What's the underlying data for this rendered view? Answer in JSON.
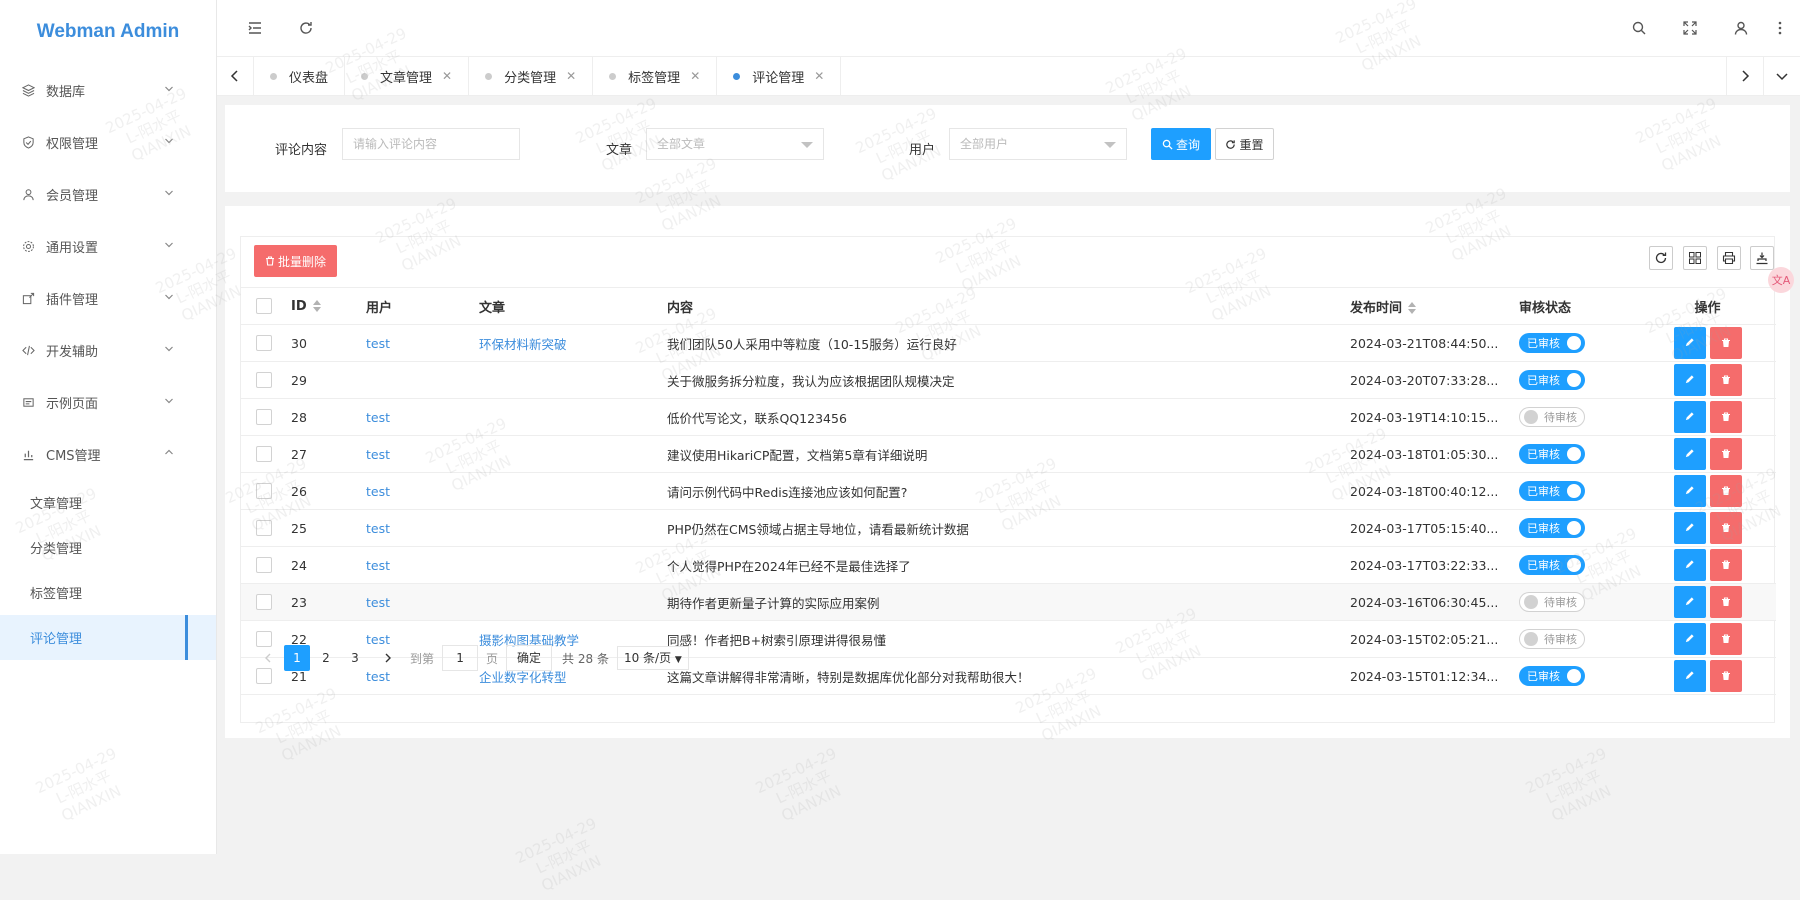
{
  "app": {
    "title": "Webman Admin"
  },
  "sidebar": {
    "items": [
      {
        "label": "数据库",
        "icon": "layers-icon"
      },
      {
        "label": "权限管理",
        "icon": "shield-icon"
      },
      {
        "label": "会员管理",
        "icon": "user-icon"
      },
      {
        "label": "通用设置",
        "icon": "gear-icon"
      },
      {
        "label": "插件管理",
        "icon": "plugin-icon"
      },
      {
        "label": "开发辅助",
        "icon": "code-icon"
      },
      {
        "label": "示例页面",
        "icon": "page-icon"
      },
      {
        "label": "CMS管理",
        "icon": "cms-icon"
      }
    ],
    "cms_children": [
      "文章管理",
      "分类管理",
      "标签管理",
      "评论管理"
    ],
    "active": "评论管理"
  },
  "tabs": [
    {
      "label": "仪表盘",
      "closable": false
    },
    {
      "label": "文章管理",
      "closable": true
    },
    {
      "label": "分类管理",
      "closable": true
    },
    {
      "label": "标签管理",
      "closable": true
    },
    {
      "label": "评论管理",
      "closable": true,
      "active": true
    }
  ],
  "search": {
    "content_label": "评论内容",
    "content_placeholder": "请输入评论内容",
    "article_label": "文章",
    "article_value": "全部文章",
    "user_label": "用户",
    "user_value": "全部用户",
    "query_label": "查询",
    "reset_label": "重置"
  },
  "toolbar": {
    "batch_delete_label": "批量删除"
  },
  "table": {
    "headers": {
      "id": "ID",
      "user": "用户",
      "article": "文章",
      "content": "内容",
      "time": "发布时间",
      "status": "审核状态",
      "actions": "操作"
    },
    "rows": [
      {
        "id": "30",
        "user": "test",
        "article": "环保材料新突破",
        "content": "我们团队50人采用中等粒度（10-15服务）运行良好",
        "time": "2024-03-21T08:44:50...",
        "status": "已审核",
        "approved": true
      },
      {
        "id": "29",
        "user": "",
        "article": "",
        "content": "关于微服务拆分粒度，我认为应该根据团队规模决定",
        "time": "2024-03-20T07:33:28...",
        "status": "已审核",
        "approved": true
      },
      {
        "id": "28",
        "user": "test",
        "article": "",
        "content": "低价代写论文，联系QQ123456",
        "time": "2024-03-19T14:10:15...",
        "status": "待审核",
        "approved": false
      },
      {
        "id": "27",
        "user": "test",
        "article": "",
        "content": "建议使用HikariCP配置，文档第5章有详细说明",
        "time": "2024-03-18T01:05:30...",
        "status": "已审核",
        "approved": true
      },
      {
        "id": "26",
        "user": "test",
        "article": "",
        "content": "请问示例代码中Redis连接池应该如何配置?",
        "time": "2024-03-18T00:40:12...",
        "status": "已审核",
        "approved": true
      },
      {
        "id": "25",
        "user": "test",
        "article": "",
        "content": "PHP仍然在CMS领域占据主导地位，请看最新统计数据",
        "time": "2024-03-17T05:15:40...",
        "status": "已审核",
        "approved": true
      },
      {
        "id": "24",
        "user": "test",
        "article": "",
        "content": "个人觉得PHP在2024年已经不是最佳选择了",
        "time": "2024-03-17T03:22:33...",
        "status": "已审核",
        "approved": true
      },
      {
        "id": "23",
        "user": "test",
        "article": "",
        "content": "期待作者更新量子计算的实际应用案例",
        "time": "2024-03-16T06:30:45...",
        "status": "待审核",
        "approved": false
      },
      {
        "id": "22",
        "user": "test",
        "article": "摄影构图基础教学",
        "content": "同感！作者把B+树索引原理讲得很易懂",
        "time": "2024-03-15T02:05:21...",
        "status": "待审核",
        "approved": false
      },
      {
        "id": "21",
        "user": "test",
        "article": "企业数字化转型",
        "content": "这篇文章讲解得非常清晰，特别是数据库优化部分对我帮助很大！",
        "time": "2024-03-15T01:12:34...",
        "status": "已审核",
        "approved": true
      }
    ]
  },
  "pagination": {
    "pages": [
      "1",
      "2",
      "3"
    ],
    "current": "1",
    "goto_label": "到第",
    "goto_value": "1",
    "page_unit": "页",
    "confirm_label": "确定",
    "total_label": "共 28 条",
    "page_size": "10 条/页"
  },
  "float_button": {
    "label": "文A"
  },
  "watermark": {
    "date": "2025-04-29",
    "name": "L-阳水平",
    "code": "QIANXIN"
  },
  "colors": {
    "primary": "#1e9fff",
    "danger": "#f56c6c",
    "logo": "#3c8ddc"
  }
}
